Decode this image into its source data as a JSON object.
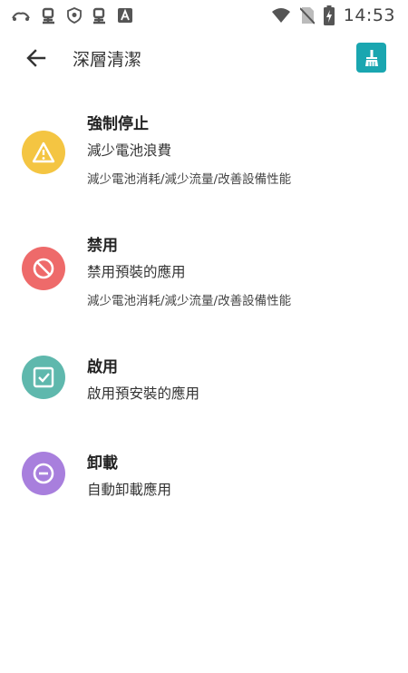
{
  "status_bar": {
    "time": "14:53",
    "left_icons": [
      "cloud-sync-icon",
      "bug-icon",
      "shield-icon",
      "bug-icon",
      "keyboard-a-icon"
    ],
    "right_icons": [
      "wifi-icon",
      "no-sim-icon",
      "battery-charging-icon"
    ]
  },
  "app_bar": {
    "title": "深層清潔",
    "back_icon": "arrow-left-icon",
    "action_icon": "broom-clean-icon",
    "accent": "#1aa6b0"
  },
  "items": [
    {
      "title": "強制停止",
      "subtitle": "減少電池浪費",
      "description": "減少電池消耗/減少流量/改善設備性能",
      "icon": "warning-triangle-icon",
      "color": "#f4c542"
    },
    {
      "title": "禁用",
      "subtitle": "禁用預裝的應用",
      "description": "減少電池消耗/減少流量/改善設備性能",
      "icon": "prohibited-icon",
      "color": "#ee6a6a"
    },
    {
      "title": "啟用",
      "subtitle": "啟用預安裝的應用",
      "icon": "checkbox-checked-icon",
      "color": "#5fb8ad"
    },
    {
      "title": "卸載",
      "subtitle": "自動卸載應用",
      "icon": "minus-circle-icon",
      "color": "#a87fdd"
    }
  ]
}
